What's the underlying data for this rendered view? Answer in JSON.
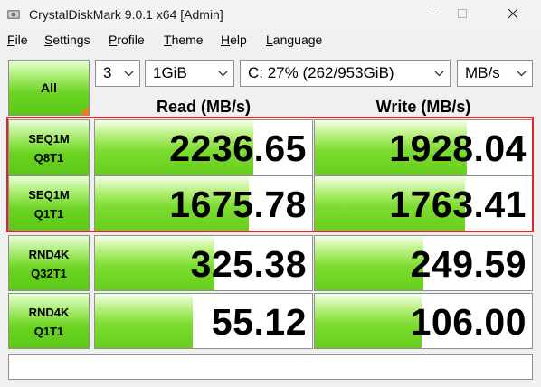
{
  "window": {
    "title": "CrystalDiskMark 9.0.1 x64 [Admin]"
  },
  "menu": {
    "items": [
      {
        "mnemonic": "F",
        "rest": "ile"
      },
      {
        "mnemonic": "S",
        "rest": "ettings"
      },
      {
        "mnemonic": "P",
        "rest": "rofile"
      },
      {
        "mnemonic": "T",
        "rest": "heme"
      },
      {
        "mnemonic": "H",
        "rest": "elp"
      },
      {
        "mnemonic": "L",
        "rest": "anguage"
      }
    ]
  },
  "controls": {
    "all_label": "All",
    "count": "3",
    "size": "1GiB",
    "drive": "C: 27% (262/953GiB)",
    "unit": "MB/s"
  },
  "headers": {
    "read": "Read (MB/s)",
    "write": "Write (MB/s)"
  },
  "tests": [
    {
      "line1": "SEQ1M",
      "line2": "Q8T1",
      "read": "2236.65",
      "write": "1928.04",
      "read_fill": 0.73,
      "write_fill": 0.7
    },
    {
      "line1": "SEQ1M",
      "line2": "Q1T1",
      "read": "1675.78",
      "write": "1763.41",
      "read_fill": 0.71,
      "write_fill": 0.69
    },
    {
      "line1": "RND4K",
      "line2": "Q32T1",
      "read": "325.38",
      "write": "249.59",
      "read_fill": 0.55,
      "write_fill": 0.5
    },
    {
      "line1": "RND4K",
      "line2": "Q1T1",
      "read": "55.12",
      "write": "106.00",
      "read_fill": 0.45,
      "write_fill": 0.49
    }
  ],
  "colors": {
    "highlight": "#d52b2b",
    "bar_green": "#66cf1c",
    "corner_orange": "#f07a17"
  },
  "comment": ""
}
